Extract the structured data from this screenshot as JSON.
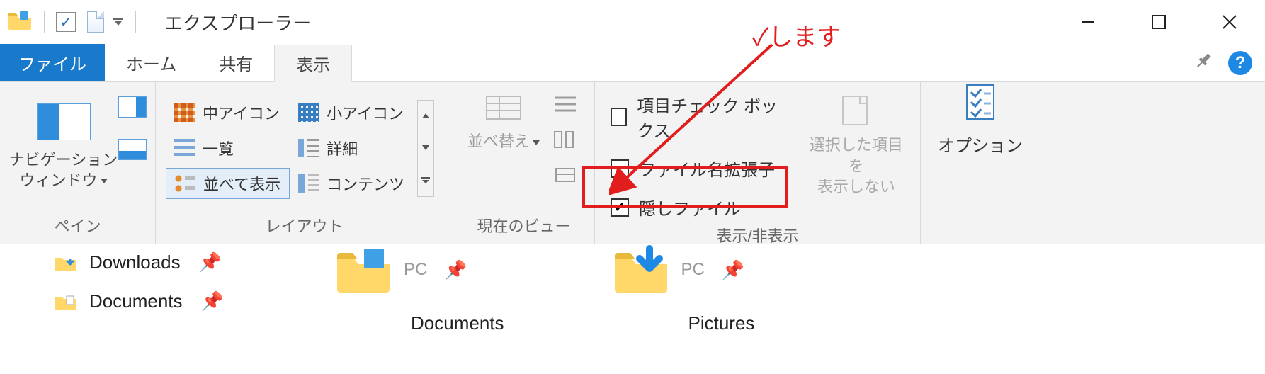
{
  "titlebar": {
    "title": "エクスプローラー"
  },
  "tabs": {
    "file": "ファイル",
    "home": "ホーム",
    "share": "共有",
    "view": "表示"
  },
  "ribbon": {
    "panes": {
      "nav_label_l1": "ナビゲーション",
      "nav_label_l2": "ウィンドウ",
      "group_label": "ペイン"
    },
    "layout": {
      "medium": "中アイコン",
      "small": "小アイコン",
      "list": "一覧",
      "details": "詳細",
      "tiles": "並べて表示",
      "content": "コンテンツ",
      "group_label": "レイアウト"
    },
    "curview": {
      "sort": "並べ替え",
      "group_label": "現在のビュー"
    },
    "showhide": {
      "item_checkboxes": "項目チェック ボックス",
      "file_ext": "ファイル名拡張子",
      "hidden_files": "隠しファイル",
      "hide_selected_l1": "選択した項目を",
      "hide_selected_l2": "表示しない",
      "group_label": "表示/非表示"
    },
    "options": {
      "label": "オプション"
    }
  },
  "content": {
    "sidebar": {
      "downloads": "Downloads",
      "documents": "Documents"
    },
    "main": {
      "pc1": "PC",
      "documents": "Documents",
      "pc2": "PC",
      "pictures": "Pictures"
    }
  },
  "annotation": {
    "text": "✓します"
  }
}
